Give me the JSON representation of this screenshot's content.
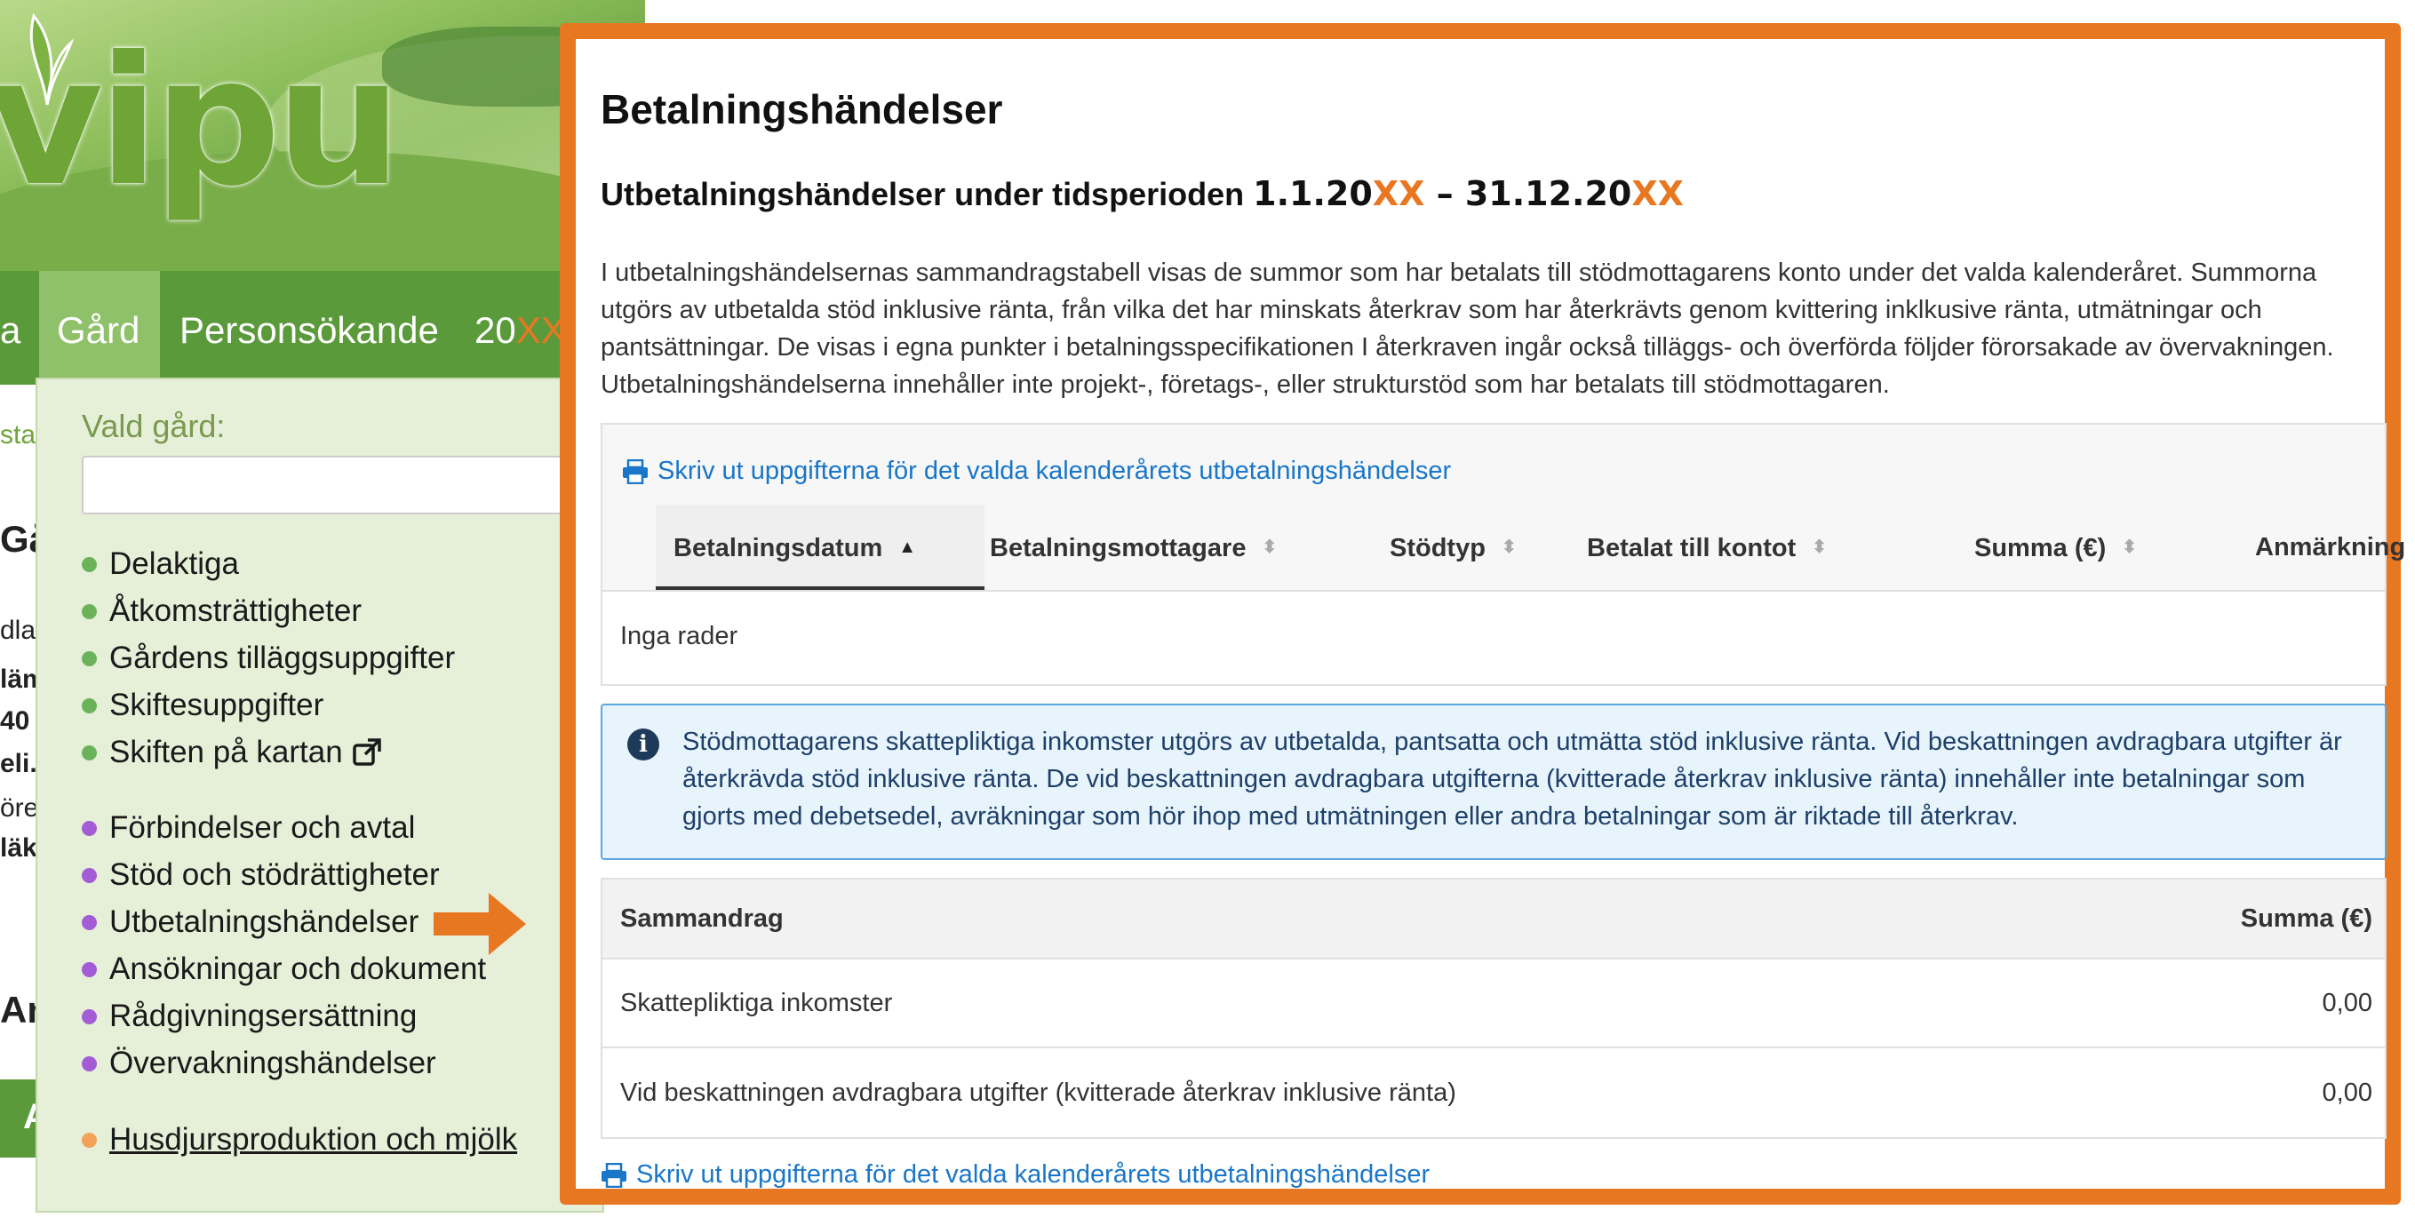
{
  "background_page": {
    "logo_text": "vipu",
    "nav": {
      "first_fragment": "a",
      "gard": "Gård",
      "personsokande": "Personsökande",
      "year_prefix": "20",
      "year_suffix": "XX"
    },
    "fragments": [
      "sta",
      "Gå",
      "dla",
      "läm",
      "40",
      "eli.",
      "öre",
      "läk",
      "An",
      "A"
    ]
  },
  "dropdown": {
    "label": "Vald gård:",
    "input_value": "",
    "group1": [
      {
        "label": "Delaktiga"
      },
      {
        "label": "Åtkomsträttigheter"
      },
      {
        "label": "Gårdens tilläggsuppgifter"
      },
      {
        "label": "Skiftesuppgifter"
      },
      {
        "label": "Skiften på kartan"
      }
    ],
    "group2": [
      {
        "label": "Förbindelser och avtal"
      },
      {
        "label": "Stöd och stödrättigheter"
      },
      {
        "label": "Utbetalningshändelser"
      },
      {
        "label": "Ansökningar och dokument"
      },
      {
        "label": "Rådgivningsersättning"
      },
      {
        "label": "Övervakningshändelser"
      }
    ],
    "group3": [
      {
        "label": "Husdjursproduktion och mjölk"
      }
    ],
    "colors": {
      "group1_dot": "#6bb35a",
      "group2_dot": "#a35bd6",
      "group3_dot": "#f3a25a",
      "arrow": "#e87722"
    }
  },
  "main": {
    "title": "Betalningshändelser",
    "period_label": "Utbetalningshändelser under tidsperioden",
    "period_start_prefix": "1.1.20",
    "period_end_prefix": "31.12.20",
    "period_placeholder": "XX",
    "period_separator": "–",
    "description": "I utbetalningshändelsernas sammandragstabell visas de summor som har betalats till stödmottagarens konto under det valda kalenderåret. Summorna utgörs av utbetalda stöd inklusive ränta, från vilka det har minskats återkrav som har återkrävts genom kvittering inklkusive ränta, utmätningar och pantsättningar. De visas i egna punkter i betalningsspecifikationen I återkraven ingår också tilläggs- och överförda följder förorsakade av övervakningen. Utbetalningshändelserna innehåller inte projekt-, företags-, eller strukturstöd som har betalats till stödmottagaren.",
    "print_link": "Skriv ut uppgifterna för det valda kalenderårets utbetalningshändelser",
    "table": {
      "columns": [
        "Betalningsdatum",
        "Betalningsmottagare",
        "Stödtyp",
        "Betalat till kontot",
        "Summa (€)",
        "Anmärkning"
      ],
      "sorted_column": "Betalningsdatum",
      "sort_direction": "ascending",
      "empty_text": "Inga rader"
    },
    "info_text": "Stödmottagarens skattepliktiga inkomster utgörs av utbetalda, pantsatta och utmätta stöd inklusive ränta. Vid beskattningen avdragbara utgifter är återkrävda stöd inklusive ränta. De vid beskattningen avdragbara utgifterna (kvitterade återkrav inklusive ränta) innehåller inte betalningar som gjorts med debetsedel, avräkningar som hör ihop med utmätningen eller andra betalningar som är riktade till återkrav.",
    "summary": {
      "header_left": "Sammandrag",
      "header_right": "Summa (€)",
      "rows": [
        {
          "label": "Skattepliktiga inkomster",
          "value": "0,00"
        },
        {
          "label": "Vid beskattningen avdragbara utgifter (kvitterade återkrav inklusive ränta)",
          "value": "0,00"
        }
      ]
    },
    "colors": {
      "highlight_border": "#e87722",
      "link": "#1976c8",
      "info_bg": "#e7f4fb",
      "info_border": "#5aa8e0"
    }
  }
}
